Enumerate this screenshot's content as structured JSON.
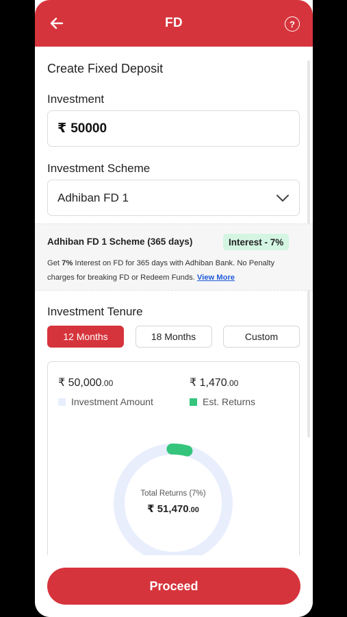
{
  "header": {
    "title": "FD",
    "help_label": "?"
  },
  "page": {
    "heading": "Create Fixed Deposit"
  },
  "investment": {
    "label": "Investment",
    "currency": "₹",
    "value": "50000"
  },
  "scheme": {
    "label": "Investment Scheme",
    "selected": "Adhiban FD 1",
    "name": "Adhiban FD 1 Scheme (365 days)",
    "interest_badge": "Interest - 7%",
    "desc_prefix": "Get ",
    "desc_rate": "7%",
    "desc_body": " Interest on FD for 365 days with Adhiban Bank. No Penalty charges for breaking FD or Redeem Funds. ",
    "view_more": "View More"
  },
  "tenure": {
    "label": "Investment Tenure",
    "options": [
      "12 Months",
      "18 Months",
      "Custom"
    ],
    "selected": "12 Months"
  },
  "summary": {
    "investment_amount": "₹ 50,000",
    "investment_decimals": ".00",
    "investment_legend": "Investment Amount",
    "returns_amount": "₹ 1,470",
    "returns_decimals": ".00",
    "returns_legend": "Est. Returns",
    "total_label": "Total Returns (7%)",
    "total_amount": "₹ 51,470",
    "total_decimals": ".00",
    "returns_share": 0.028
  },
  "colors": {
    "brand": "#d6343c",
    "returns": "#34c47c",
    "investment": "#e8eefc",
    "interest_badge_bg": "#d4f5e2",
    "link": "#1f5bd8"
  },
  "actions": {
    "proceed": "Proceed"
  }
}
